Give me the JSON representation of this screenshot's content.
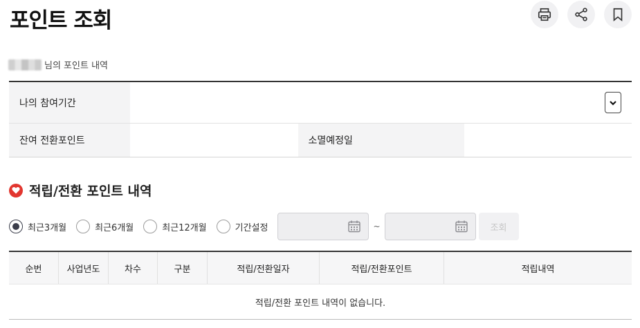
{
  "page": {
    "title": "포인트 조회"
  },
  "actions": {
    "print": "print-icon",
    "share": "share-icon",
    "bookmark": "bookmark-icon"
  },
  "user": {
    "suffix": "님의 포인트 내역"
  },
  "info": {
    "period_label": "나의 참여기간",
    "period_value": "",
    "balance_label": "잔여 전환포인트",
    "balance_value": "",
    "expire_label": "소멸예정일",
    "expire_value": ""
  },
  "section": {
    "title": "적립/전환 포인트 내역",
    "icon": "heart-icon",
    "accent": "#e2362f"
  },
  "filters": {
    "options": [
      "최근3개월",
      "최근6개월",
      "최근12개월",
      "기간설정"
    ],
    "selected": "최근3개월",
    "range_separator": "~",
    "start_date": "",
    "end_date": "",
    "search_label": "조회"
  },
  "table": {
    "headers": [
      "순번",
      "사업년도",
      "차수",
      "구분",
      "적립/전환일자",
      "적립/전환포인트",
      "적립내역"
    ],
    "empty_message": "적립/전환 포인트 내역이 없습니다."
  }
}
